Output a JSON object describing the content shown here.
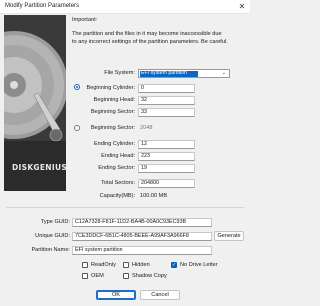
{
  "window": {
    "title": "Modify Partition Parameters",
    "close_glyph": "✕"
  },
  "art": {
    "brand": "DISKGENIUS",
    "registered": "®"
  },
  "important": {
    "heading": "Important:",
    "line1": "The partition and the files in it may become inaccessible due",
    "line2": "to any incorrect settings of the partition parameters. Be careful."
  },
  "file_system": {
    "label": "File System:",
    "value": "EFI system partition",
    "icon": "chevron-down-icon"
  },
  "begin": {
    "cylinder_label": "Beginning Cylinder:",
    "cylinder": "0",
    "head_label": "Beginning Head:",
    "head": "32",
    "sector_label": "Beginning Sector:",
    "sector": "33",
    "sector2_label": "Beginning Sector:",
    "sector2": "2048"
  },
  "end": {
    "cylinder_label": "Ending Cylinder:",
    "cylinder": "12",
    "head_label": "Ending Head:",
    "head": "223",
    "sector_label": "Ending Sector:",
    "sector": "19"
  },
  "totals": {
    "total_label": "Total Sectors:",
    "total": "204800",
    "capacity_label": "Capacity(MB):",
    "capacity": "100.00 MB"
  },
  "guids": {
    "type_label": "Type GUID:",
    "type": "C12A7328-F81F-11D2-BA4B-00A0C93EC93B",
    "unique_label": "Unique GUID:",
    "unique": "7CE3DDCF-6B1C-4805-BEEE-A99AF3A966F8",
    "generate": "Generate",
    "name_label": "Partition Name:",
    "name": "EFI system partition"
  },
  "attributes": {
    "readonly": "ReadOnly",
    "hidden": "Hidden",
    "nodrive": "No Drive Letter",
    "oem": "OEM",
    "shadow": "Shadow Copy",
    "check_glyph": "✓"
  },
  "buttons": {
    "ok": "OK",
    "cancel": "Cancel"
  },
  "colors": {
    "accent": "#0b67c6",
    "art_bg": "#3a3a3a"
  }
}
